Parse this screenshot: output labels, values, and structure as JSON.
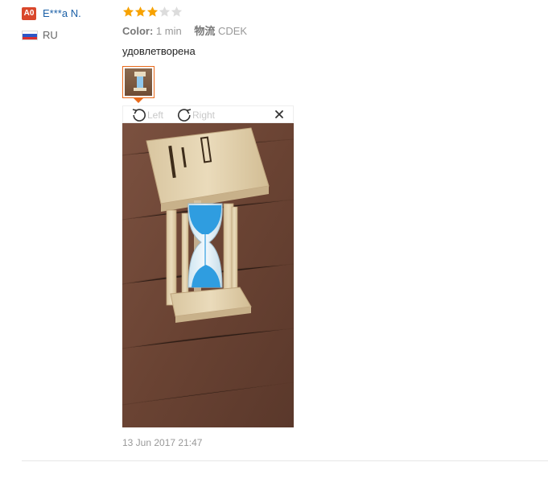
{
  "user": {
    "badge": "A0",
    "name": "E***a N.",
    "country_code": "RU"
  },
  "rating": {
    "value": 3,
    "max": 5,
    "filled_color": "#f7a200",
    "empty_color": "#dcdcdc"
  },
  "meta": {
    "color_label": "Color:",
    "color_value": "1 min",
    "logistics_label": "物流",
    "logistics_value": "CDEK"
  },
  "feedback_text": "удовлетворена",
  "viewer": {
    "rotate_left_label": "Left",
    "rotate_right_label": "Right",
    "close_icon": "close-icon"
  },
  "photo": {
    "subject": "hourglass-photo",
    "sand_color": "#2f9de0",
    "wood_color": "#e3d2b0",
    "background_color": "#6b4432"
  },
  "date": "13 Jun 2017 21:47",
  "colors": {
    "accent": "#e96a1a",
    "badge": "#d9472b",
    "username": "#1a5fa6"
  }
}
